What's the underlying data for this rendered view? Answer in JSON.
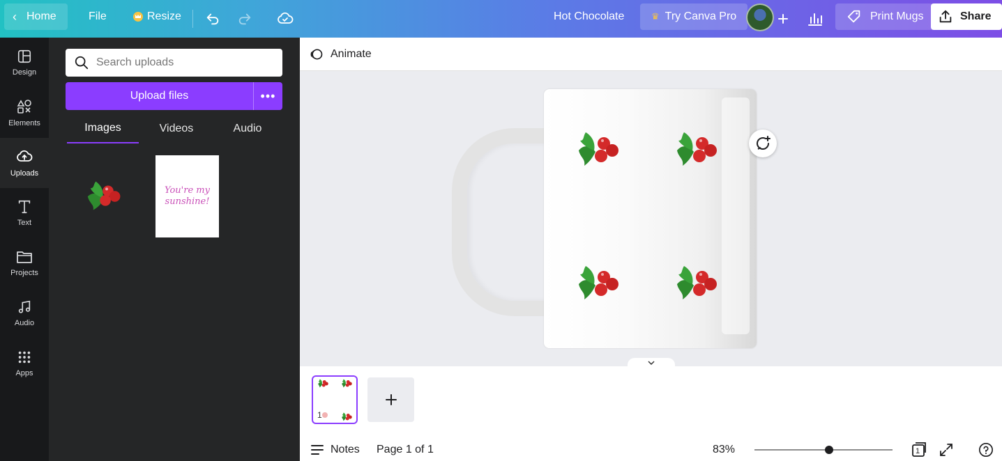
{
  "topbar": {
    "home_label": "Home",
    "file_label": "File",
    "resize_label": "Resize",
    "design_title": "Hot Chocolate",
    "try_pro_label": "Try Canva Pro",
    "print_label": "Print Mugs",
    "share_label": "Share"
  },
  "rail": {
    "items": [
      {
        "label": "Design",
        "icon": "layout-icon"
      },
      {
        "label": "Elements",
        "icon": "shapes-icon"
      },
      {
        "label": "Uploads",
        "icon": "cloud-upload-icon"
      },
      {
        "label": "Text",
        "icon": "text-icon"
      },
      {
        "label": "Projects",
        "icon": "folder-icon"
      },
      {
        "label": "Audio",
        "icon": "music-icon"
      },
      {
        "label": "Apps",
        "icon": "grid-icon"
      }
    ],
    "active": "Uploads"
  },
  "panel": {
    "search_placeholder": "Search uploads",
    "upload_label": "Upload files",
    "more_label": "•••",
    "tabs": [
      "Images",
      "Videos",
      "Audio"
    ],
    "active_tab": "Images",
    "card_text": "You're my sunshine!"
  },
  "animate_label": "Animate",
  "bottom": {
    "page_number": "1",
    "notes_label": "Notes",
    "page_count": "Page 1 of 1",
    "zoom": "83%",
    "zoom_fraction": 0.54,
    "pages_badge": "1"
  },
  "colors": {
    "accent": "#8b3dff",
    "holly_leaf": "#2e8b2e",
    "berry": "#d42a2a"
  }
}
